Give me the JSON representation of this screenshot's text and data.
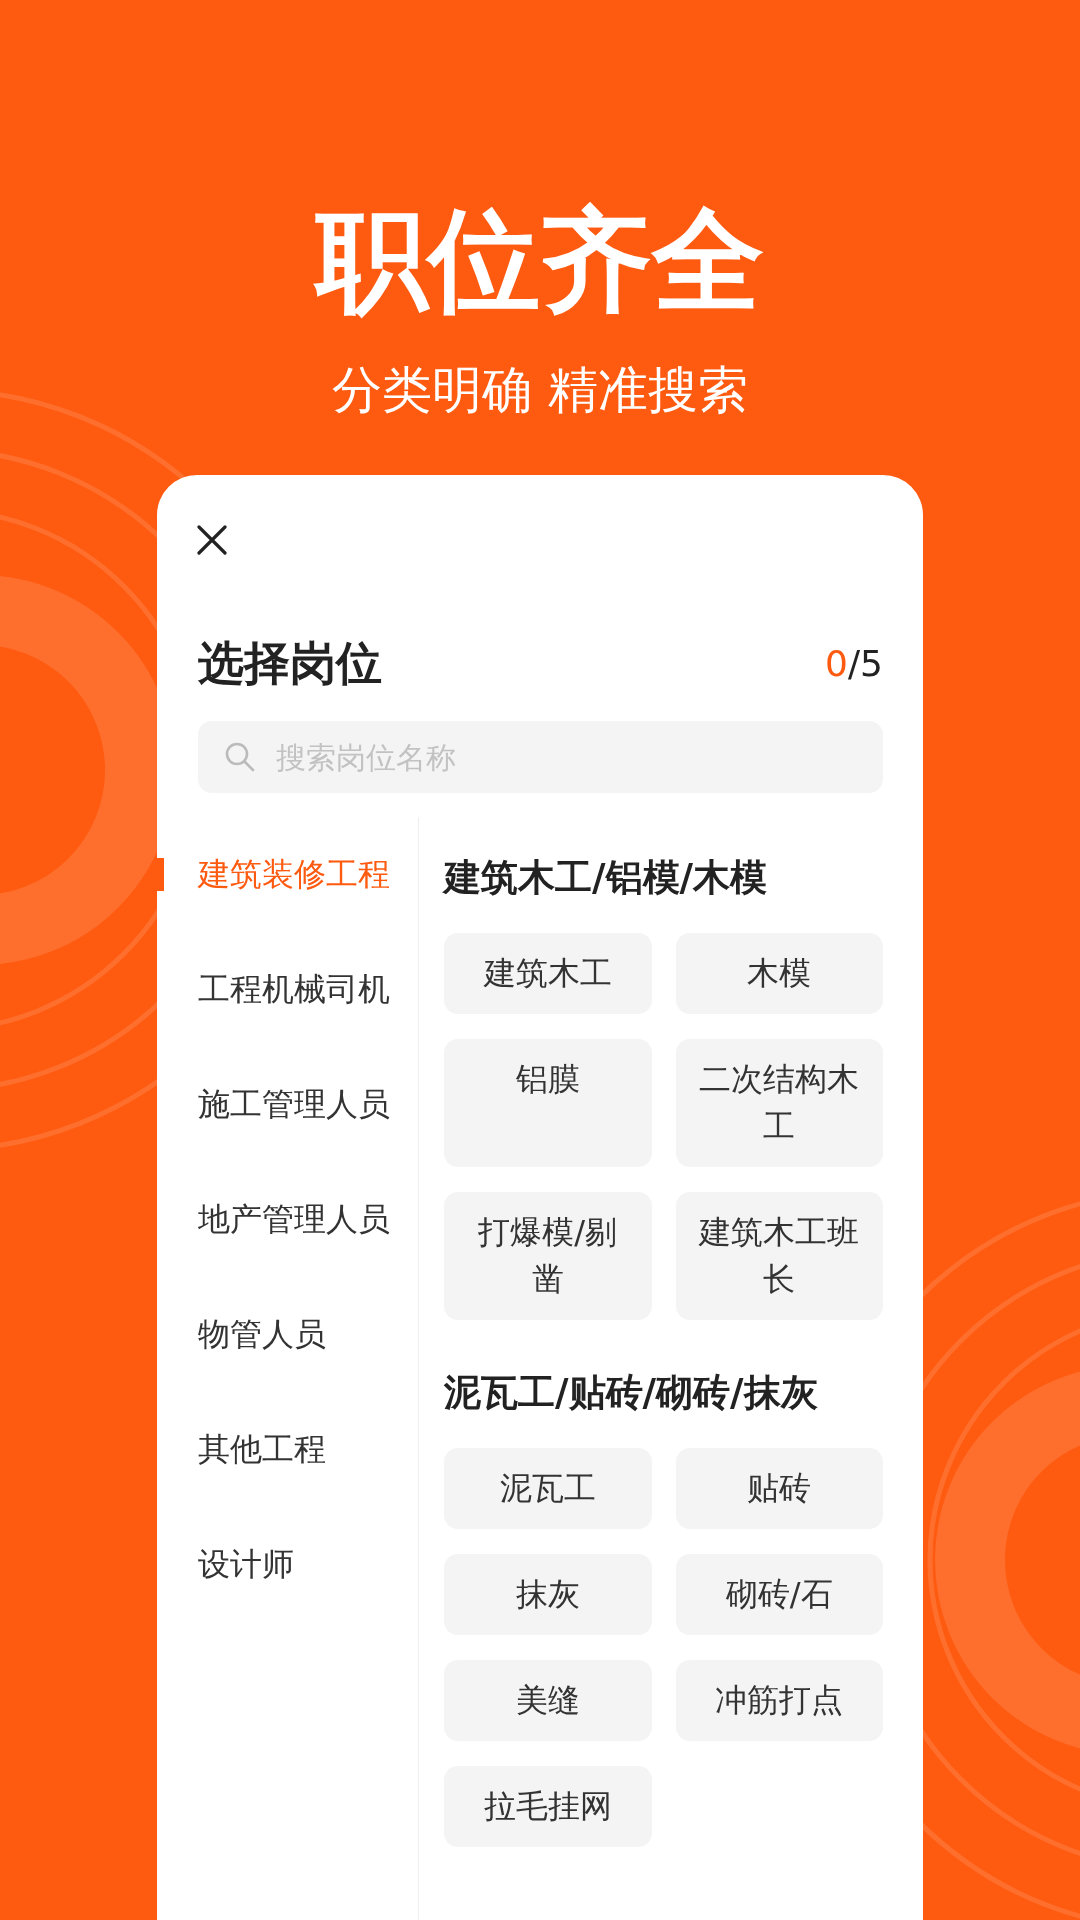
{
  "headline": "职位齐全",
  "subheadline": "分类明确 精准搜索",
  "sheet": {
    "title": "选择岗位",
    "selected_count": "0",
    "limit": "/5",
    "search": {
      "placeholder": "搜索岗位名称"
    },
    "categories": [
      {
        "label": "建筑装修工程",
        "selected": true
      },
      {
        "label": "工程机械司机",
        "selected": false
      },
      {
        "label": "施工管理人员",
        "selected": false
      },
      {
        "label": "地产管理人员",
        "selected": false
      },
      {
        "label": "物管人员",
        "selected": false
      },
      {
        "label": "其他工程",
        "selected": false
      },
      {
        "label": "设计师",
        "selected": false
      }
    ],
    "groups": [
      {
        "title": "建筑木工/铝模/木模",
        "options": [
          "建筑木工",
          "木模",
          "铝膜",
          "二次结构木工",
          "打爆模/剔凿",
          "建筑木工班长"
        ]
      },
      {
        "title": "泥瓦工/贴砖/砌砖/抹灰",
        "options": [
          "泥瓦工",
          "贴砖",
          "抹灰",
          "砌砖/石",
          "美缝",
          "冲筋打点",
          "拉毛挂网"
        ]
      }
    ]
  }
}
